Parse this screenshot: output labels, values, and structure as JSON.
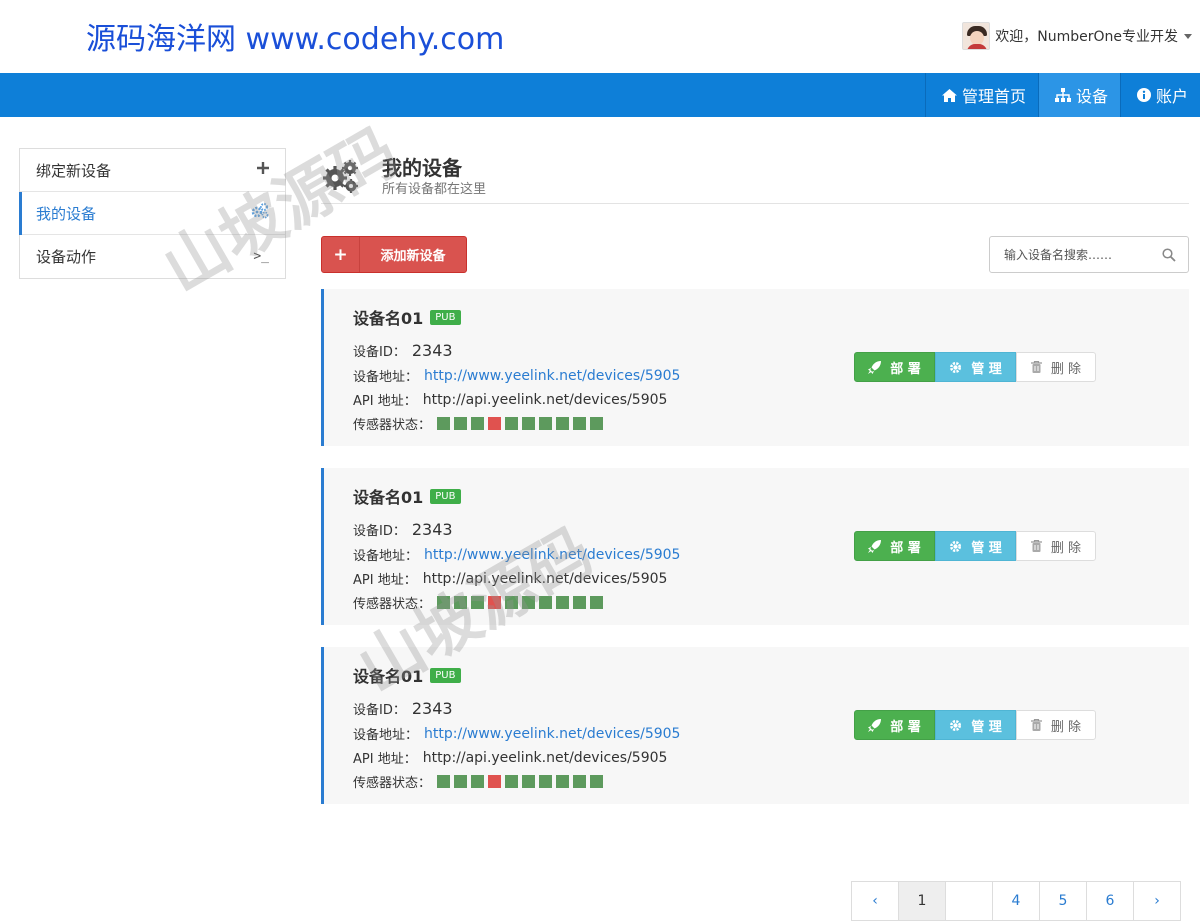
{
  "header": {
    "brand": "源码海洋网 www.codehy.com",
    "welcome": "欢迎，NumberOne专业开发"
  },
  "nav": [
    {
      "label": "管理首页",
      "icon": "home-icon"
    },
    {
      "label": "设备",
      "icon": "sitemap-icon"
    },
    {
      "label": "账户",
      "icon": "info-icon"
    }
  ],
  "sidebar": {
    "items": [
      {
        "label": "绑定新设备",
        "icon": "plus-icon"
      },
      {
        "label": "我的设备",
        "icon": "cogs-icon"
      },
      {
        "label": "设备动作",
        "icon": "terminal-icon",
        "glyph": ">_"
      }
    ]
  },
  "page": {
    "title": "我的设备",
    "subtitle": "所有设备都在这里",
    "add_label": "添加新设备",
    "add_icon": "+",
    "search_placeholder": "输入设备名搜索……"
  },
  "devices": [
    {
      "name": "设备名01",
      "badge": "PUB",
      "id_label": "设备ID：",
      "id": "2343",
      "addr_label": "设备地址：",
      "addr": "http://www.yeelink.net/devices/5905",
      "api_label": "API 地址：",
      "api": "http://api.yeelink.net/devices/5905",
      "sensor_label": "传感器状态：",
      "sensors": [
        "ok",
        "ok",
        "ok",
        "bad",
        "ok",
        "ok",
        "ok",
        "ok",
        "ok",
        "ok"
      ]
    },
    {
      "name": "设备名01",
      "badge": "PUB",
      "id_label": "设备ID：",
      "id": "2343",
      "addr_label": "设备地址：",
      "addr": "http://www.yeelink.net/devices/5905",
      "api_label": "API 地址：",
      "api": "http://api.yeelink.net/devices/5905",
      "sensor_label": "传感器状态：",
      "sensors": [
        "ok",
        "ok",
        "ok",
        "bad",
        "ok",
        "ok",
        "ok",
        "ok",
        "ok",
        "ok"
      ]
    },
    {
      "name": "设备名01",
      "badge": "PUB",
      "id_label": "设备ID：",
      "id": "2343",
      "addr_label": "设备地址：",
      "addr": "http://www.yeelink.net/devices/5905",
      "api_label": "API 地址：",
      "api": "http://api.yeelink.net/devices/5905",
      "sensor_label": "传感器状态：",
      "sensors": [
        "ok",
        "ok",
        "ok",
        "bad",
        "ok",
        "ok",
        "ok",
        "ok",
        "ok",
        "ok"
      ]
    }
  ],
  "actions": {
    "deploy": "部 署",
    "manage": "管 理",
    "delete": "删 除"
  },
  "pagination": [
    "‹",
    "1",
    "",
    "4",
    "5",
    "6",
    "›"
  ],
  "watermark": "山坡源码",
  "colors": {
    "nav": "#0e7fd8",
    "accent": "#2a7cd1",
    "danger": "#d9534f",
    "success": "#4cb04f",
    "info": "#5bc0de",
    "sensor_ok": "#5d9a5d",
    "sensor_bad": "#e0524f"
  }
}
